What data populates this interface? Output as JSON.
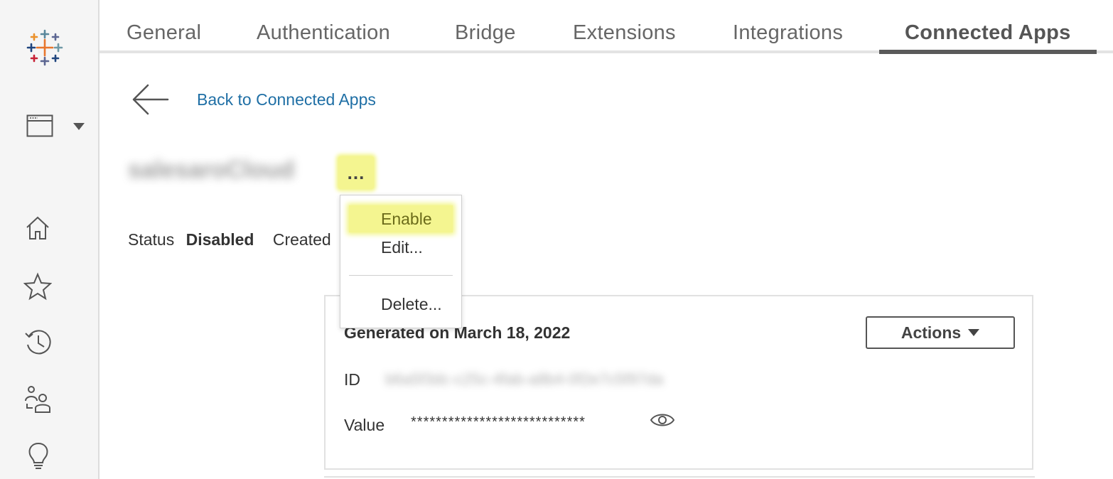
{
  "sidebar": {
    "icons": [
      "tableau-logo-icon",
      "window-icon",
      "caret-down-icon",
      "home-icon",
      "star-icon",
      "recent-icon",
      "users-icon",
      "lightbulb-icon"
    ]
  },
  "tabs": [
    {
      "label": "General",
      "active": false
    },
    {
      "label": "Authentication",
      "active": false
    },
    {
      "label": "Bridge",
      "active": false
    },
    {
      "label": "Extensions",
      "active": false
    },
    {
      "label": "Integrations",
      "active": false
    },
    {
      "label": "Connected Apps",
      "active": true
    }
  ],
  "back_link": "Back to Connected Apps",
  "app": {
    "name": "salesaroCloud",
    "more_label": "...",
    "status_label": "Status",
    "status_value": "Disabled",
    "created_label": "Created"
  },
  "menu": {
    "enable": "Enable",
    "edit": "Edit...",
    "delete": "Delete..."
  },
  "secret": {
    "generated": "Generated on March 18, 2022",
    "actions_label": "Actions",
    "id_label": "ID",
    "id_value": "b6a5f3dc-c25c-4fab-a8b4-0f2e7c5f97da",
    "value_label": "Value",
    "value_masked": "****************************"
  },
  "colors": {
    "link": "#1f6fa5",
    "highlight": "#f4f590",
    "active_tab_underline": "#5a5a5a"
  }
}
